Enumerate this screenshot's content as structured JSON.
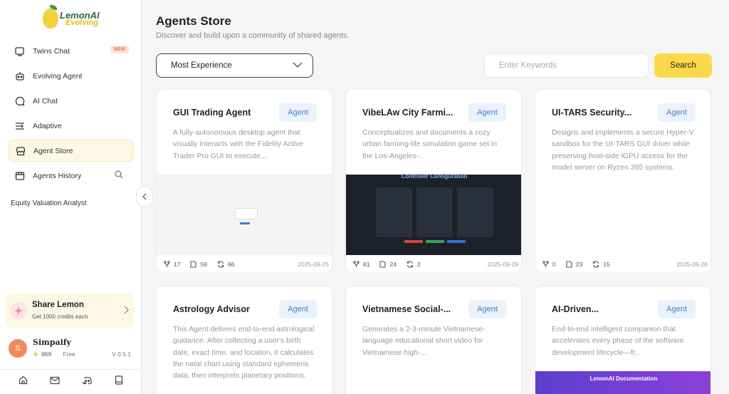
{
  "brand": {
    "name": "LemonAI",
    "tagline": "Evolving"
  },
  "nav": {
    "items": [
      {
        "label": "Twins Chat",
        "icon": "twins-chat-icon",
        "badge": "NEW"
      },
      {
        "label": "Evolving Agent",
        "icon": "robot-icon"
      },
      {
        "label": "AI Chat",
        "icon": "chat-bubble-icon"
      },
      {
        "label": "Adaptive",
        "icon": "adaptive-icon"
      },
      {
        "label": "Agent Store",
        "icon": "store-icon",
        "active": true
      },
      {
        "label": "Agents History",
        "icon": "history-icon"
      }
    ],
    "recent": "Equity Valuation Analyst"
  },
  "share": {
    "title": "Share Lemon",
    "subtitle": "Get 1000 credits each"
  },
  "user": {
    "initial": "S",
    "name": "Simpaify",
    "credits": "969",
    "plan": "Free",
    "version": "V 0.5.1"
  },
  "header": {
    "title": "Agents Store",
    "subtitle": "Discover and build upon a community of shared agents."
  },
  "filters": {
    "sort_selected": "Most Experience",
    "search_placeholder": "Enter Keywords",
    "search_label": "Search"
  },
  "cards": [
    {
      "name": "GUI Trading Agent",
      "badge": "Agent",
      "desc": "A fully-autonomous desktop agent that visually interacts with the Fidelity Active Trader Pro GUI to execute...",
      "forks": "17",
      "files": "59",
      "runs": "66",
      "date": "2025-09-25"
    },
    {
      "name": "VibeLAw City Farmi...",
      "badge": "Agent",
      "desc": "Conceptualizes and documents a cozy urban farming-life simulation game set in the Los-Angeles-...",
      "forks": "81",
      "files": "24",
      "runs": "2",
      "date": "2025-09-29",
      "thumb_title": "Controller Configuration"
    },
    {
      "name": "UI-TARS Security...",
      "badge": "Agent",
      "desc": "Designs and implements a secure Hyper-V sandbox for the UI-TARS GUI driver while preserving host-side iGPU access for the model server on Ryzen 395 systems.",
      "forks": "0",
      "files": "23",
      "runs": "15",
      "date": "2025-09-26"
    },
    {
      "name": "Astrology Advisor",
      "badge": "Agent",
      "desc": "This Agent delivers end-to-end astrological guidance. After collecting a user's birth date, exact time, and location, it calculates the natal chart using standard ephemeris data, then interprets planetary positions,"
    },
    {
      "name": "Vietnamese Social-...",
      "badge": "Agent",
      "desc": "Generates a 2-3-minute Vietnamese-language educational short video for Vietnamese high-..."
    },
    {
      "name": "AI-Driven...",
      "badge": "Agent",
      "desc": "End-to-end intelligent companion that accelerates every phase of the software development lifecycle—fr...",
      "thumb_title": "LemonAI Documentation"
    }
  ]
}
